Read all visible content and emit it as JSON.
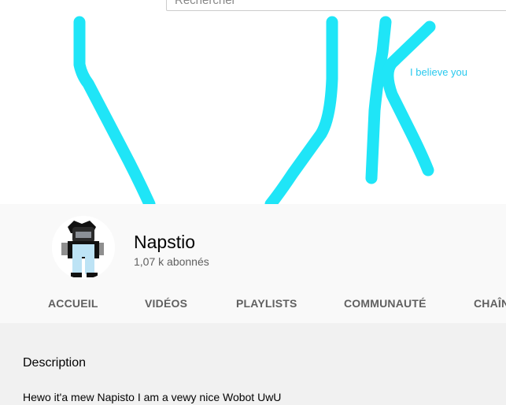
{
  "search": {
    "placeholder": "Rechercher"
  },
  "banner": {
    "caption": "I believe you",
    "stroke_color": "#1fe5f7",
    "caption_color": "#29c9ee"
  },
  "channel": {
    "name": "Napstio",
    "subscribers": "1,07 k abonnés"
  },
  "tabs": [
    {
      "label": "ACCUEIL"
    },
    {
      "label": "VIDÉOS"
    },
    {
      "label": "PLAYLISTS"
    },
    {
      "label": "COMMUNAUTÉ"
    },
    {
      "label": "CHAÎNES"
    }
  ],
  "about": {
    "description_title": "Description",
    "description_text": "Hewo it'a mew Napisto I am a vewy nice Wobot UwU"
  }
}
